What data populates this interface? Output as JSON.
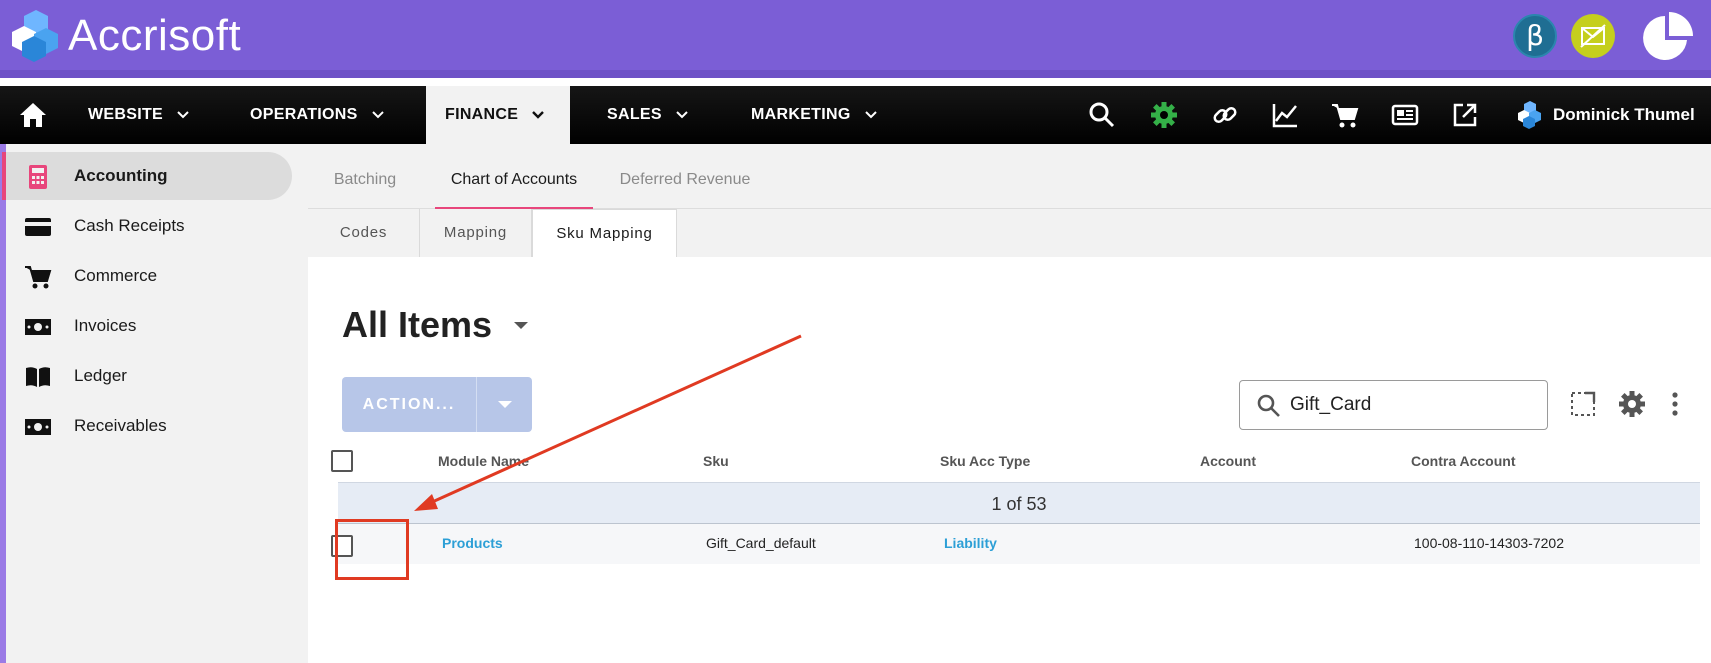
{
  "brand": {
    "name": "Accrisoft",
    "beta_symbol": "β"
  },
  "nav": {
    "items": [
      {
        "label": "WEBSITE"
      },
      {
        "label": "OPERATIONS"
      },
      {
        "label": "FINANCE",
        "active": true
      },
      {
        "label": "SALES"
      },
      {
        "label": "MARKETING"
      }
    ],
    "user_name": "Dominick Thumel",
    "tools": [
      "search-icon",
      "gear-icon",
      "link-icon",
      "chart-icon",
      "cart-icon",
      "news-icon",
      "external-link-icon"
    ]
  },
  "sidebar": {
    "items": [
      {
        "label": "Accounting",
        "icon": "calculator-icon",
        "active": true
      },
      {
        "label": "Cash Receipts",
        "icon": "credit-card-icon"
      },
      {
        "label": "Commerce",
        "icon": "cart-icon"
      },
      {
        "label": "Invoices",
        "icon": "money-icon"
      },
      {
        "label": "Ledger",
        "icon": "book-icon"
      },
      {
        "label": "Receivables",
        "icon": "money-icon"
      }
    ]
  },
  "subtabs": [
    {
      "label": "Batching"
    },
    {
      "label": "Chart of Accounts",
      "active": true
    },
    {
      "label": "Deferred Revenue"
    }
  ],
  "tabs": [
    {
      "label": "Codes"
    },
    {
      "label": "Mapping"
    },
    {
      "label": "Sku Mapping",
      "active": true
    }
  ],
  "main": {
    "title": "All Items",
    "action_label": "ACTION...",
    "search_value": "Gift_Card"
  },
  "table": {
    "headers": [
      "Module Name",
      "Sku",
      "Sku Acc Type",
      "Account",
      "Contra Account"
    ],
    "pager": "1 of 53",
    "rows": [
      {
        "module": "Products",
        "sku": "Gift_Card_default",
        "sku_acc_type": "Liability",
        "account": "",
        "contra_account": "100-08-110-14303-7202"
      }
    ]
  },
  "colors": {
    "brand_bar": "#7b5ed6",
    "accent_pink": "#e8467c",
    "link_blue": "#2c9fd6",
    "annotation_red": "#e03a22"
  }
}
